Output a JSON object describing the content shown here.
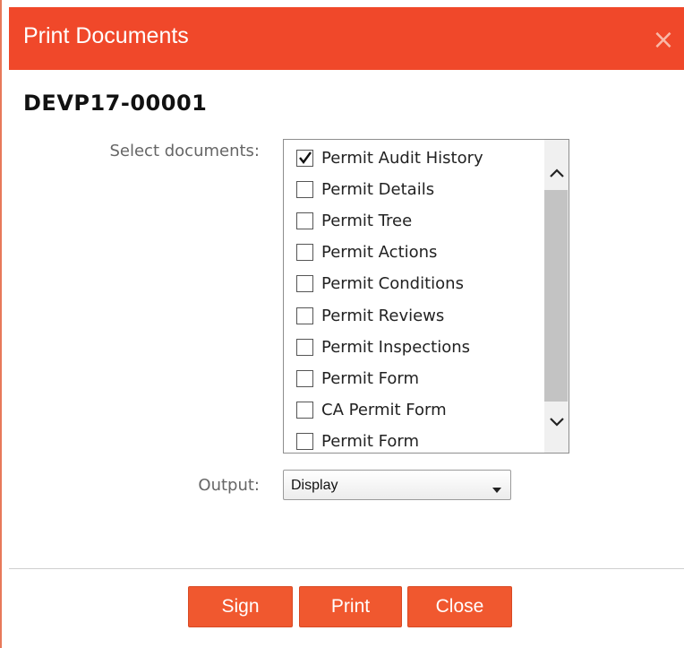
{
  "dialog": {
    "title": "Print Documents",
    "close_icon": "close-icon",
    "record_id": "DEVP17-00001"
  },
  "documents": {
    "label": "Select documents:",
    "items": [
      {
        "label": "Permit Audit History",
        "checked": true
      },
      {
        "label": "Permit Details",
        "checked": false
      },
      {
        "label": "Permit Tree",
        "checked": false
      },
      {
        "label": "Permit Actions",
        "checked": false
      },
      {
        "label": "Permit Conditions",
        "checked": false
      },
      {
        "label": "Permit Reviews",
        "checked": false
      },
      {
        "label": "Permit Inspections",
        "checked": false
      },
      {
        "label": "Permit Form",
        "checked": false
      },
      {
        "label": "CA Permit Form",
        "checked": false
      },
      {
        "label": "Permit Form",
        "checked": false
      }
    ]
  },
  "output": {
    "label": "Output:",
    "selected": "Display"
  },
  "buttons": {
    "sign": "Sign",
    "print": "Print",
    "close": "Close"
  },
  "colors": {
    "titlebar": "#f0482a",
    "button": "#f0582f"
  }
}
